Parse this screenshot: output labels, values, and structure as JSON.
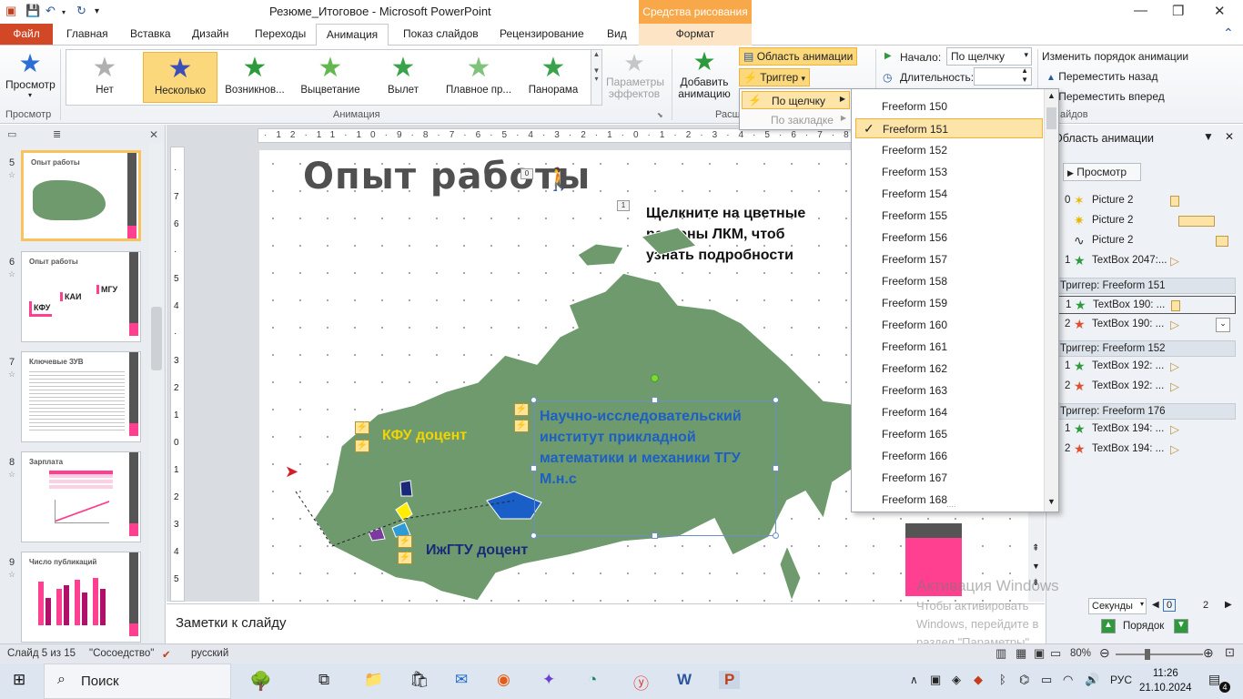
{
  "window": {
    "title": "Резюме_Итоговое  -  Microsoft PowerPoint",
    "context_tab": "Средства рисования",
    "minimize": "—",
    "maximize": "❐",
    "close": "✕"
  },
  "tabs": [
    "Файл",
    "Главная",
    "Вставка",
    "Дизайн",
    "Переходы",
    "Анимация",
    "Показ слайдов",
    "Рецензирование",
    "Вид",
    "Формат"
  ],
  "ribbon": {
    "preview_label": "Просмотр",
    "preview_group": "Просмотр",
    "animation_group": "Анимация",
    "gallery": [
      {
        "label": "Нет",
        "color": "#b0b0b0"
      },
      {
        "label": "Несколько",
        "color": "#3a4fb8"
      },
      {
        "label": "Возникнов...",
        "color": "#2e9a3e"
      },
      {
        "label": "Выцветание",
        "color": "#62b84e"
      },
      {
        "label": "Вылет",
        "color": "#3aa24a"
      },
      {
        "label": "Плавное пр...",
        "color": "#7fc27a"
      },
      {
        "label": "Панорама",
        "color": "#3aa24a"
      }
    ],
    "effect_params": "Параметры эффектов",
    "add_animation": "Добавить анимацию",
    "ext_group_partial": "Расш",
    "anim_pane_btn": "Область анимации",
    "trigger_btn": "Триггер",
    "start_label": "Начало:",
    "start_value": "По щелчку",
    "duration_label": "Длительность:",
    "reorder_title": "Изменить порядок анимации",
    "move_back": "Переместить назад",
    "move_forward": "Переместить вперед",
    "timing_group_partial": "айдов"
  },
  "trigger_menu": {
    "on_click": "По щелчку",
    "on_bookmark": "По закладке"
  },
  "freeform_list": {
    "items": [
      "Freeform 150",
      "Freeform 151",
      "Freeform 152",
      "Freeform 153",
      "Freeform 154",
      "Freeform 155",
      "Freeform 156",
      "Freeform 157",
      "Freeform 158",
      "Freeform 159",
      "Freeform 160",
      "Freeform 161",
      "Freeform 162",
      "Freeform 163",
      "Freeform 164",
      "Freeform 165",
      "Freeform 166",
      "Freeform 167",
      "Freeform 168"
    ],
    "selected": "Freeform 151",
    "check": "✓"
  },
  "slides": [
    {
      "num": "5",
      "title": "Опыт работы"
    },
    {
      "num": "6",
      "title": "Опыт работы",
      "labels": [
        "КФУ",
        "КАИ",
        "МГУ"
      ]
    },
    {
      "num": "7",
      "title": "Ключевые ЗУВ"
    },
    {
      "num": "8",
      "title": "Зарплата"
    },
    {
      "num": "9",
      "title": "Число публикаций"
    }
  ],
  "slide": {
    "title": "Опыт работы",
    "tag0": "0",
    "tag1": "1",
    "hint": "Щелкните на цветные регионы ЛКМ, чтоб узнать подробности",
    "kfu": "КФУ доцент",
    "izh": "ИжГТУ доцент",
    "nii": "Научно-исследовательский институт прикладной математики и механики ТГУ М.н.с"
  },
  "notes": "Заметки к слайду",
  "anim_pane": {
    "title": "Область анимации",
    "preview": "Просмотр",
    "items": [
      {
        "num": "0",
        "label": "Picture 2"
      },
      {
        "num": "",
        "label": "Picture 2"
      },
      {
        "num": "",
        "label": "Picture 2"
      },
      {
        "num": "1",
        "label": "TextBox 2047:..."
      }
    ],
    "triggers": [
      {
        "title": "Триггер: Freeform 151",
        "items": [
          {
            "num": "1",
            "label": "TextBox 190: ..."
          },
          {
            "num": "2",
            "label": "TextBox 190: ..."
          }
        ]
      },
      {
        "title": "Триггер: Freeform 152",
        "items": [
          {
            "num": "1",
            "label": "TextBox 192: ..."
          },
          {
            "num": "2",
            "label": "TextBox 192: ..."
          }
        ]
      },
      {
        "title": "Триггер: Freeform 176",
        "items": [
          {
            "num": "1",
            "label": "TextBox 194: ..."
          },
          {
            "num": "2",
            "label": "TextBox 194: ..."
          }
        ]
      }
    ],
    "seconds_label": "Секунды",
    "seconds_value": "0",
    "seconds_max": "2",
    "order_label": "Порядок"
  },
  "status": {
    "slide_info": "Слайд 5 из 15",
    "theme": "\"Сосоедство\"",
    "language": "русский",
    "zoom": "80%"
  },
  "watermark": {
    "line1": "Активация Windows",
    "line2": "Чтобы активировать Windows, перейдите в раздел \"Параметры\"."
  },
  "taskbar": {
    "search": "Поиск",
    "lang": "РУС",
    "time": "11:26",
    "date": "21.10.2024",
    "notifications": "4"
  }
}
